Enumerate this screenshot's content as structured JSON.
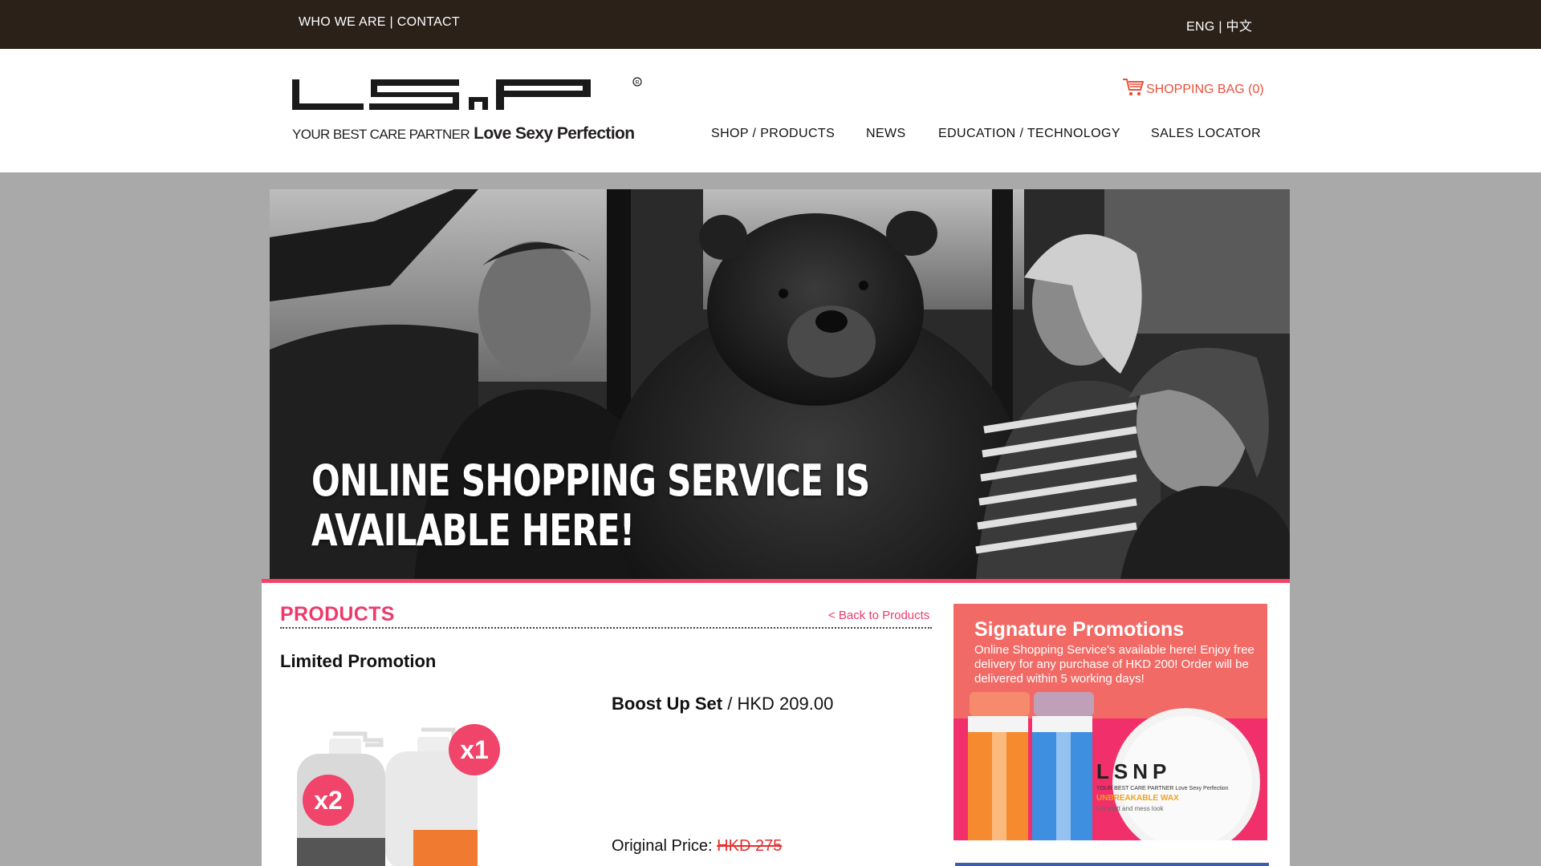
{
  "topbar": {
    "who_we_are": "WHO WE ARE",
    "separator": " | ",
    "contact": "CONTACT",
    "lang_eng": "ENG",
    "lang_zh": "中文"
  },
  "header": {
    "logo_text": "LSNP",
    "tagline_small": "YOUR BEST CARE PARTNER",
    "tagline_big": "Love Sexy Perfection",
    "cart_label": "SHOPPING BAG (0)",
    "nav": [
      "SHOP / PRODUCTS",
      "NEWS",
      "EDUCATION / TECHNOLOGY",
      "SALES LOCATOR"
    ]
  },
  "hero": {
    "line1": "ONLINE SHOPPING SERVICE IS",
    "line2": "AVAILABLE HERE!"
  },
  "main": {
    "section_title": "PRODUCTS",
    "back_link": "< Back to Products",
    "subheading": "Limited Promotion",
    "product_name": "Boost Up Set",
    "product_price": " / HKD 209.00",
    "original_price_label": "Original Price: ",
    "original_price_value": "HKD 275",
    "badge_1": "x2",
    "badge_2": "x1"
  },
  "promo": {
    "title": "Signature Promotions",
    "text": "Online Shopping Service's available here! Enjoy free delivery for any purchase of HKD 200! Order will be delivered within 5 working days!",
    "wax_brand": "LSNP",
    "wax_tag": "YOUR BEST CARE PARTNER Love Sexy Perfection",
    "wax_name": "UNBREAKABLE WAX",
    "wax_sub": "For matt and mess look"
  },
  "colors": {
    "topbar_bg": "#2b2119",
    "accent_pink": "#ee3a6a",
    "cart_red": "#e8513a",
    "promo_top": "#f26a66",
    "promo_bottom": "#f02f6b"
  }
}
